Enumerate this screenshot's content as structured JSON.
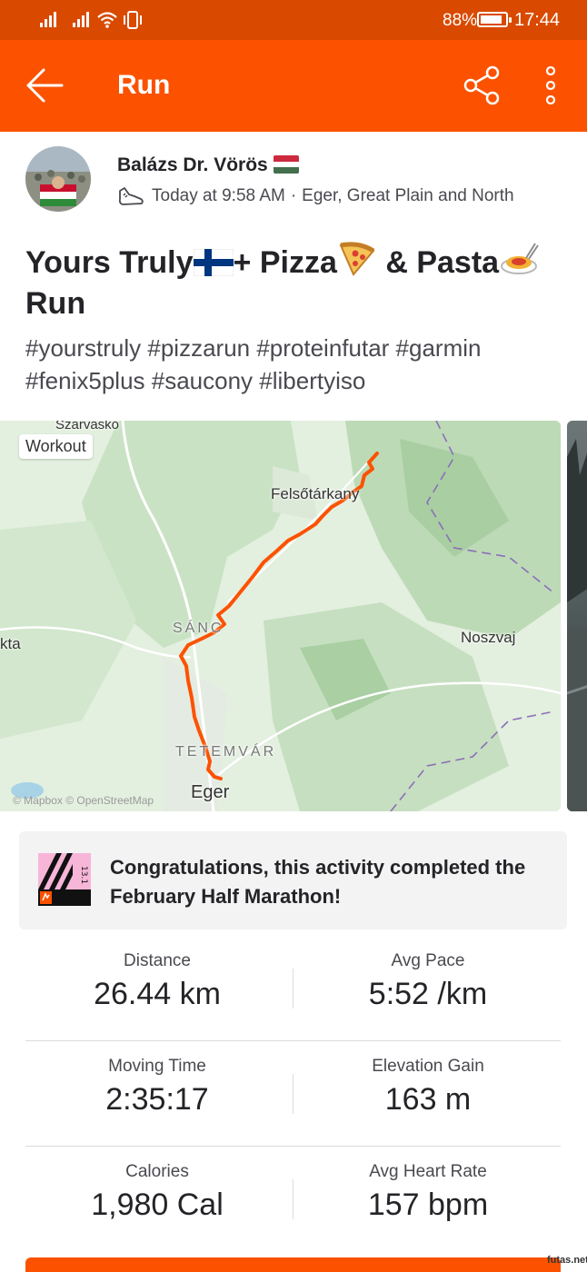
{
  "status_bar": {
    "battery_text": "88%",
    "battery_level": 0.88,
    "clock": "17:44"
  },
  "app_bar": {
    "title": "Run",
    "back_icon": "arrow-left-icon",
    "share_icon": "share-icon",
    "more_icon": "more-vertical-icon"
  },
  "athlete": {
    "name": "Balázs Dr. Vörös",
    "flag": "hungary-flag",
    "sport_icon": "running-shoe-icon",
    "time": "Today at 9:58 AM",
    "separator": "·",
    "location": "Eger, Great Plain and North"
  },
  "activity": {
    "title_parts": [
      "Yours Truly",
      "+ Pizza",
      " & Pasta",
      " Run"
    ],
    "title_icons": [
      "finland-flag",
      "pizza-icon",
      "spaghetti-icon"
    ],
    "description": "#yourstruly #pizzarun #proteinfutar #garmin #fenix5plus #saucony #libertyiso"
  },
  "map": {
    "badge": "Workout",
    "labels": {
      "szarvasko": "Szarvaskő",
      "felsotarkany": "Felsőtárkany",
      "sanc": "SÁNC",
      "noszvaj": "Noszvaj",
      "kta": "kta",
      "tetemvar": "TETEMVÁR",
      "eger": "Eger"
    },
    "attribution": "© Mapbox © OpenStreetMap",
    "route_color": "#fc5200"
  },
  "challenge": {
    "badge_number": "13.1",
    "text": "Congratulations, this activity completed the February Half Marathon!"
  },
  "stats": {
    "distance": {
      "label": "Distance",
      "value": "26.44 km"
    },
    "avg_pace": {
      "label": "Avg Pace",
      "value": "5:52 /km"
    },
    "moving_time": {
      "label": "Moving Time",
      "value": "2:35:17"
    },
    "elevation_gain": {
      "label": "Elevation Gain",
      "value": "163 m"
    },
    "calories": {
      "label": "Calories",
      "value": "1,980 Cal"
    },
    "avg_heart_rate": {
      "label": "Avg Heart Rate",
      "value": "157 bpm"
    }
  },
  "watermark": "futas.net",
  "colors": {
    "brand": "#fc5200",
    "status_bar": "#d94a00"
  }
}
